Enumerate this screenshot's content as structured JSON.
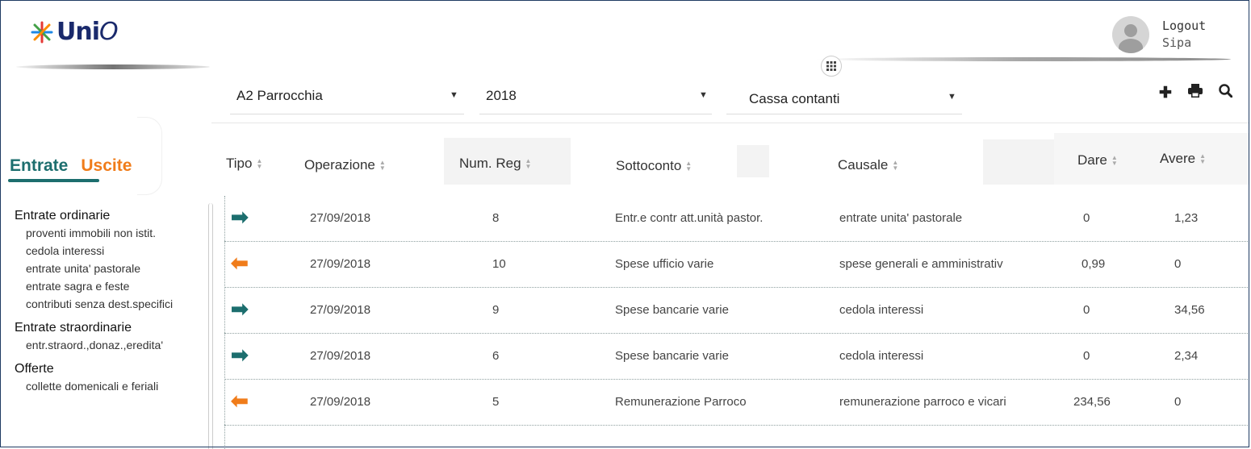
{
  "app": {
    "name": "Uni",
    "name_o": "O"
  },
  "user": {
    "logout_label": "Logout",
    "name": "Sipa"
  },
  "filters": {
    "entity": "A2 Parrocchia",
    "year": "2018",
    "account": "Cassa contanti"
  },
  "toolbar": {
    "add_icon": "plus-icon",
    "print_icon": "printer-icon",
    "search_icon": "search-icon",
    "apps_icon": "grid-icon"
  },
  "tabs": {
    "entrate": "Entrate",
    "uscite": "Uscite"
  },
  "categories": [
    {
      "title": "Entrate ordinarie",
      "items": [
        "proventi immobili non istit.",
        "cedola interessi",
        "entrate unita' pastorale",
        "entrate sagra e feste",
        "contributi senza dest.specifici"
      ]
    },
    {
      "title": "Entrate straordinarie",
      "items": [
        "entr.straord.,donaz.,eredita'"
      ]
    },
    {
      "title": "Offerte",
      "items": [
        "collette domenicali e feriali"
      ]
    }
  ],
  "columns": {
    "tipo": "Tipo",
    "operazione": "Operazione",
    "num_reg": "Num. Reg",
    "sottoconto": "Sottoconto",
    "causale": "Causale",
    "dare": "Dare",
    "avere": "Avere"
  },
  "rows": [
    {
      "tipo": "entrata",
      "arrow": "➡",
      "operazione": "27/09/2018",
      "num_reg": "8",
      "sottoconto": "Entr.e contr att.unità pastor.",
      "causale": "entrate unita' pastorale",
      "dare": "0",
      "avere": "1,23"
    },
    {
      "tipo": "uscita",
      "arrow": "⬅",
      "operazione": "27/09/2018",
      "num_reg": "10",
      "sottoconto": "Spese ufficio varie",
      "causale": "spese generali e amministrativ",
      "dare": "0,99",
      "avere": "0"
    },
    {
      "tipo": "entrata",
      "arrow": "➡",
      "operazione": "27/09/2018",
      "num_reg": "9",
      "sottoconto": "Spese bancarie varie",
      "causale": "cedola interessi",
      "dare": "0",
      "avere": "34,56"
    },
    {
      "tipo": "entrata",
      "arrow": "➡",
      "operazione": "27/09/2018",
      "num_reg": "6",
      "sottoconto": "Spese bancarie varie",
      "causale": "cedola interessi",
      "dare": "0",
      "avere": "2,34"
    },
    {
      "tipo": "uscita",
      "arrow": "⬅",
      "operazione": "27/09/2018",
      "num_reg": "5",
      "sottoconto": "Remunerazione Parroco",
      "causale": "remunerazione parroco e vicari",
      "dare": "234,56",
      "avere": "0"
    }
  ],
  "colors": {
    "brand": "#1a2a6c",
    "entrate": "#1c6e6e",
    "uscite": "#f07c1a"
  }
}
